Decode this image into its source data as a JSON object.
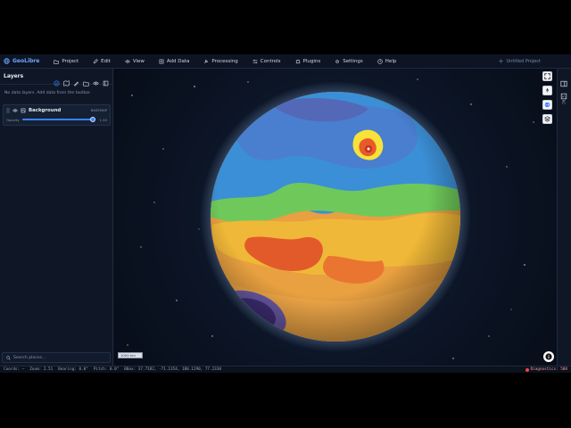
{
  "app": {
    "name": "GeoLibre",
    "project_title": "Untitled Project"
  },
  "menu": [
    {
      "label": "Project",
      "icon": "folder-icon"
    },
    {
      "label": "Edit",
      "icon": "pencil-icon"
    },
    {
      "label": "View",
      "icon": "eye-icon"
    },
    {
      "label": "Add Data",
      "icon": "plus-square-icon"
    },
    {
      "label": "Processing",
      "icon": "wrench-icon"
    },
    {
      "label": "Controls",
      "icon": "sliders-icon"
    },
    {
      "label": "Plugins",
      "icon": "puzzle-icon"
    },
    {
      "label": "Settings",
      "icon": "gear-icon"
    },
    {
      "label": "Help",
      "icon": "help-icon"
    }
  ],
  "layers_panel": {
    "title": "Layers",
    "empty_message": "No data layers. Add data from the toolbar.",
    "background_layer": {
      "name": "Background",
      "tag": "BASEMAP",
      "opacity_label": "Opacity",
      "opacity_value": "1.00",
      "opacity_fraction": 1.0
    },
    "search_placeholder": "Search places..."
  },
  "right_panel": {
    "label": "STAC"
  },
  "map": {
    "scale_label": "1000 km"
  },
  "status": {
    "coords": "Coords: —",
    "zoom": "Zoom: 2.51",
    "bearing": "Bearing: 0.0°",
    "pitch": "Pitch: 0.0°",
    "bbox": "BBox: 37.7182, -71.1354, 180.1290, 77.2330",
    "diagnostics": "Diagnostics: 500"
  }
}
